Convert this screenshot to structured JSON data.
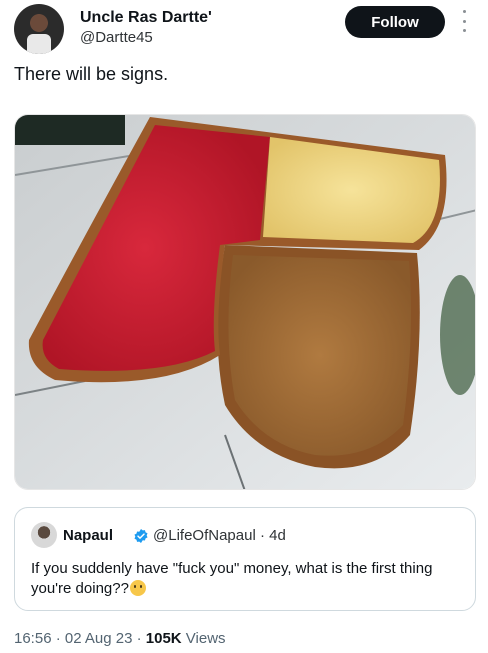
{
  "author": {
    "name": "Uncle Ras Dartte'",
    "handle": "@Dartte45"
  },
  "follow_label": "Follow",
  "tweet": {
    "text": "There will be signs."
  },
  "quote": {
    "name": "Napaul",
    "handle": "@LifeOfNapaul · 4d",
    "text": "If you suddenly have \"fuck you\" money, what is the first thing you're doing??"
  },
  "meta": {
    "time_date": "16:56 · 02 Aug 23 · ",
    "views_count": "105K",
    "views_label": " Views"
  },
  "colors": {
    "follow_bg": "#0f1419",
    "verified": "#1d9bf0",
    "jam": "#c62032",
    "peanut_butter": "#a8743d",
    "butter": "#f2dc8a"
  },
  "icons": {
    "more": "more-vertical-icon",
    "verified": "verified-badge-icon",
    "emoji": "thinking-face-emoji"
  }
}
